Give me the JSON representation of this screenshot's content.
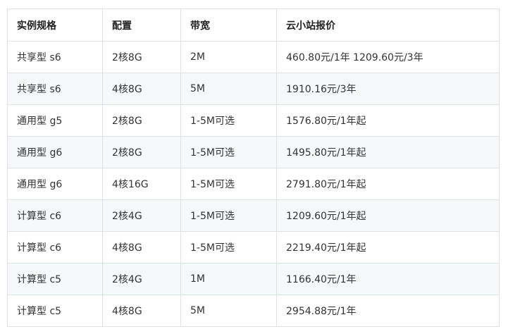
{
  "table": {
    "headers": [
      "实例规格",
      "配置",
      "带宽",
      "云小站报价"
    ],
    "rows": [
      [
        "共享型 s6",
        "2核8G",
        "2M",
        "460.80元/1年 1209.60元/3年"
      ],
      [
        "共享型 s6",
        "4核8G",
        "5M",
        "1910.16元/3年"
      ],
      [
        "通用型 g5",
        "2核8G",
        "1-5M可选",
        "1576.80元/1年起"
      ],
      [
        "通用型 g6",
        "2核8G",
        "1-5M可选",
        "1495.80元/1年起"
      ],
      [
        "通用型 g6",
        "4核16G",
        "1-5M可选",
        "2791.80元/1年起"
      ],
      [
        "计算型 c6",
        "2核4G",
        "1-5M可选",
        "1209.60元/1年起"
      ],
      [
        "计算型 c6",
        "4核8G",
        "1-5M可选",
        "2219.40元/1年起"
      ],
      [
        "计算型 c5",
        "2核4G",
        "1M",
        "1166.40元/1年"
      ],
      [
        "计算型 c5",
        "4核8G",
        "5M",
        "2954.88元/1年"
      ]
    ]
  },
  "colors": {
    "border": "#dfe2e5",
    "stripe": "#f6f8fa",
    "text": "#333333"
  }
}
